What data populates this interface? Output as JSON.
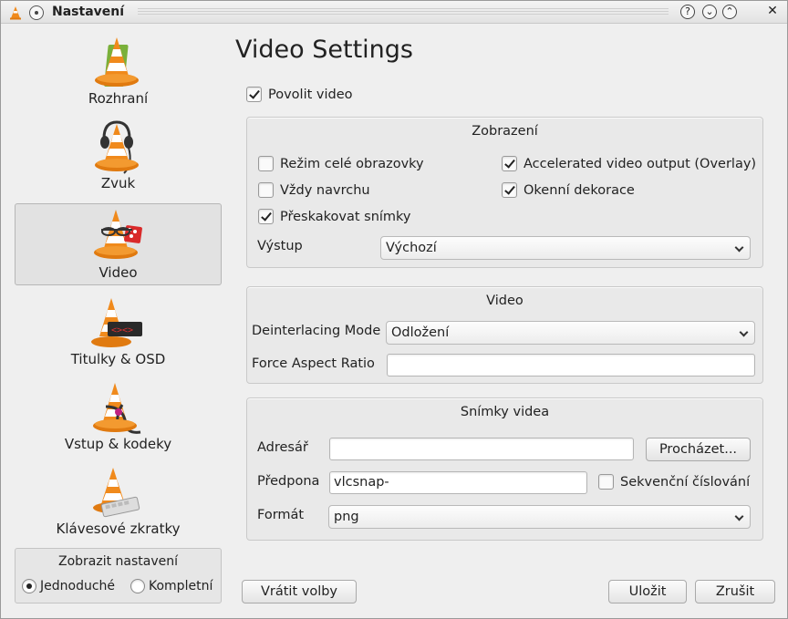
{
  "window": {
    "title": "Nastavení"
  },
  "titlebar_buttons": {
    "help": "?",
    "minimize": "⌄",
    "maximize": "⌃",
    "close": "✕"
  },
  "sidebar": {
    "items": [
      {
        "label": "Rozhraní",
        "icon": "vlc-cone-interface-icon"
      },
      {
        "label": "Zvuk",
        "icon": "vlc-cone-headphones-icon"
      },
      {
        "label": "Video",
        "icon": "vlc-cone-glasses-icon",
        "selected": true
      },
      {
        "label": "Titulky & OSD",
        "icon": "vlc-cone-subtitles-icon"
      },
      {
        "label": "Vstup & kodeky",
        "icon": "vlc-cone-cables-icon"
      },
      {
        "label": "Klávesové zkratky",
        "icon": "vlc-cone-keyboard-icon"
      }
    ]
  },
  "settings_mode": {
    "title": "Zobrazit nastavení",
    "options": [
      {
        "label": "Jednoduché",
        "checked": true
      },
      {
        "label": "Kompletní",
        "checked": false
      }
    ]
  },
  "main": {
    "title": "Video Settings",
    "enable_video": {
      "label": "Povolit video",
      "checked": true
    },
    "display": {
      "title": "Zobrazení",
      "fullscreen": {
        "label": "Režim celé obrazovky",
        "checked": false
      },
      "accelerated": {
        "label": "Accelerated video output (Overlay)",
        "checked": true
      },
      "always_on_top": {
        "label": "Vždy navrchu",
        "checked": false
      },
      "decorations": {
        "label": "Okenní dekorace",
        "checked": true
      },
      "skip_frames": {
        "label": "Přeskakovat snímky",
        "checked": true
      },
      "output_label": "Výstup",
      "output_value": "Výchozí"
    },
    "video": {
      "title": "Video",
      "deinterlace_label": "Deinterlacing Mode",
      "deinterlace_value": "Odložení",
      "aspect_label": "Force Aspect Ratio",
      "aspect_value": ""
    },
    "snapshots": {
      "title": "Snímky videa",
      "dir_label": "Adresář",
      "dir_value": "",
      "browse_label": "Procházet...",
      "prefix_label": "Předpona",
      "prefix_value": "vlcsnap-",
      "sequential": {
        "label": "Sekvenční číslování",
        "checked": false
      },
      "format_label": "Formát",
      "format_value": "png"
    }
  },
  "footer": {
    "reset_label": "Vrátit volby",
    "save_label": "Uložit",
    "cancel_label": "Zrušit"
  },
  "colors": {
    "cone_orange": "#f08a1c",
    "cone_white": "#ffffff"
  }
}
